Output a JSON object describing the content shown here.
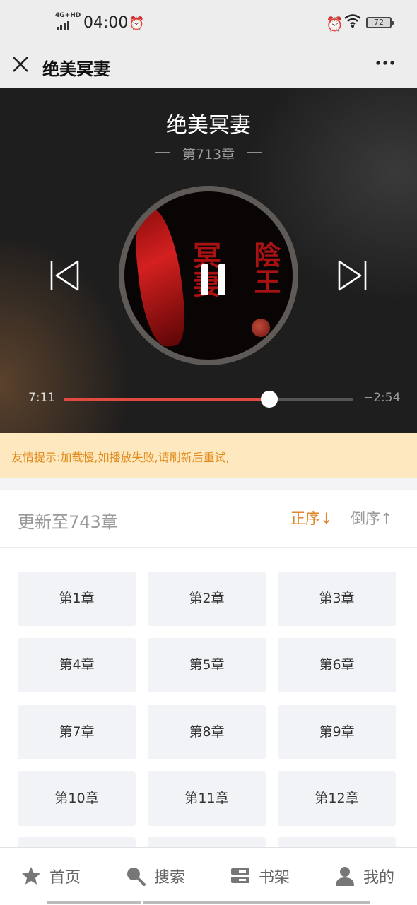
{
  "status_bar": {
    "network": "4G+HD",
    "time": "04:00",
    "battery": "72"
  },
  "titlebar": {
    "title": "绝美冥妻"
  },
  "player": {
    "book_title": "绝美冥妻",
    "chapter": "第713章",
    "elapsed": "7:11",
    "remaining": "−2:54",
    "progress": 0.71,
    "cover_text_1": "冥妻",
    "cover_text_2": "陰王",
    "colors": {
      "progress": "#e14a3e",
      "background": "#1f1e1e"
    }
  },
  "notice": {
    "text": "友情提示:加载慢,如播放失败,请刷新后重试,"
  },
  "chapter_list": {
    "updated_to": "更新至743章",
    "sort_asc": "正序↓",
    "sort_desc": "倒序↑",
    "chapters": [
      "第1章",
      "第2章",
      "第3章",
      "第4章",
      "第5章",
      "第6章",
      "第7章",
      "第8章",
      "第9章",
      "第10章",
      "第11章",
      "第12章"
    ]
  },
  "bottom_nav": [
    {
      "label": "首页",
      "icon": "star-icon"
    },
    {
      "label": "搜索",
      "icon": "search-icon"
    },
    {
      "label": "书架",
      "icon": "bookshelf-icon"
    },
    {
      "label": "我的",
      "icon": "user-icon"
    }
  ]
}
